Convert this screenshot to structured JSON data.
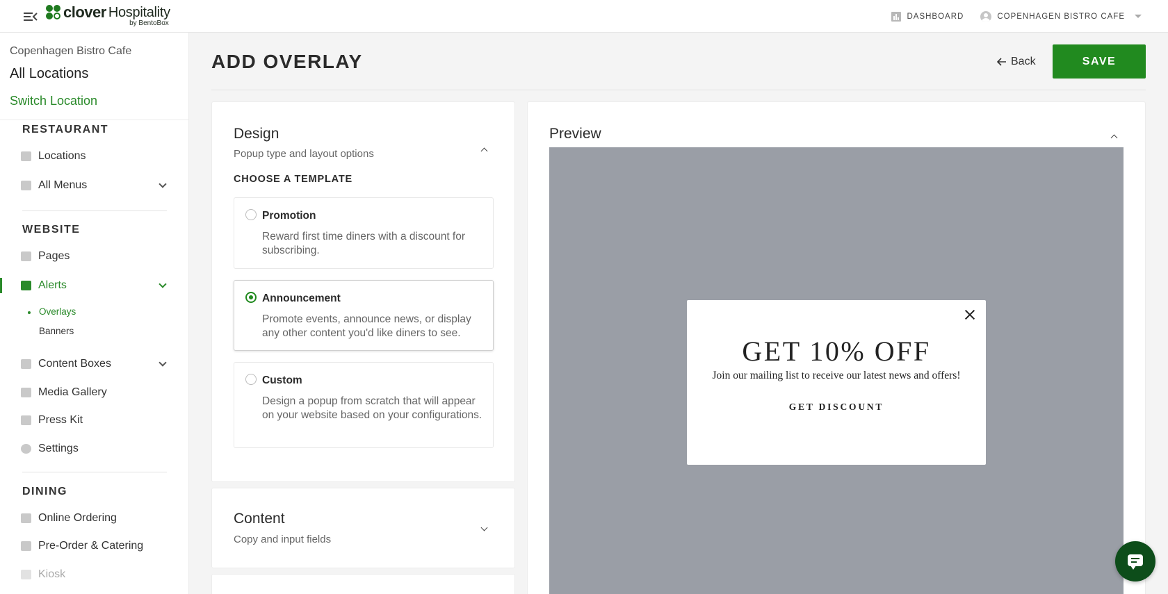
{
  "topbar": {
    "brand": "clover",
    "product": "Hospitality",
    "byline": "by BentoBox",
    "dashboard_label": "DASHBOARD",
    "account_label": "COPENHAGEN BISTRO CAFE"
  },
  "sidebar": {
    "location_name": "Copenhagen Bistro Cafe",
    "all_locations": "All Locations",
    "switch_location": "Switch Location",
    "restaurant": {
      "title": "RESTAURANT",
      "items": [
        {
          "label": "Locations",
          "icon": "storefront-icon"
        },
        {
          "label": "All Menus",
          "icon": "menu-book-icon"
        }
      ]
    },
    "website": {
      "title": "WEBSITE",
      "items": [
        {
          "label": "Pages",
          "icon": "page-icon"
        },
        {
          "label": "Alerts",
          "icon": "alert-icon"
        },
        {
          "label": "Content Boxes",
          "icon": "grid-icon"
        },
        {
          "label": "Media Gallery",
          "icon": "gallery-icon"
        },
        {
          "label": "Press Kit",
          "icon": "document-icon"
        },
        {
          "label": "Settings",
          "icon": "gear-icon"
        }
      ],
      "alerts_sub": [
        "Overlays",
        "Banners"
      ]
    },
    "dining": {
      "title": "DINING",
      "items": [
        {
          "label": "Online Ordering",
          "icon": "bag-icon"
        },
        {
          "label": "Pre-Order & Catering",
          "icon": "utensils-icon"
        },
        {
          "label": "Kiosk",
          "icon": "tablet-icon"
        }
      ]
    }
  },
  "main": {
    "title": "ADD OVERLAY",
    "back_label": "Back",
    "save_label": "SAVE",
    "design": {
      "title": "Design",
      "subtitle": "Popup type and layout options",
      "choose_label": "CHOOSE A TEMPLATE",
      "templates": [
        {
          "name": "Promotion",
          "desc": "Reward first time diners with a discount for subscribing.",
          "selected": false
        },
        {
          "name": "Announcement",
          "desc": "Promote events, announce news, or display any other content you'd like diners to see.",
          "selected": true
        },
        {
          "name": "Custom",
          "desc": "Design a popup from scratch that will appear on your website based on your configurations.",
          "selected": false
        }
      ]
    },
    "content": {
      "title": "Content",
      "subtitle": "Copy and input fields"
    },
    "preview": {
      "title": "Preview",
      "headline": "GET 10% OFF",
      "text": "Join our mailing list to receive our latest news and offers!",
      "cta": "GET DISCOUNT"
    }
  },
  "colors": {
    "brand_green": "#218a1f",
    "active_green": "#2a8a2a",
    "preview_bg": "#9a9ea6",
    "chat_bg": "#0d4d1a"
  }
}
